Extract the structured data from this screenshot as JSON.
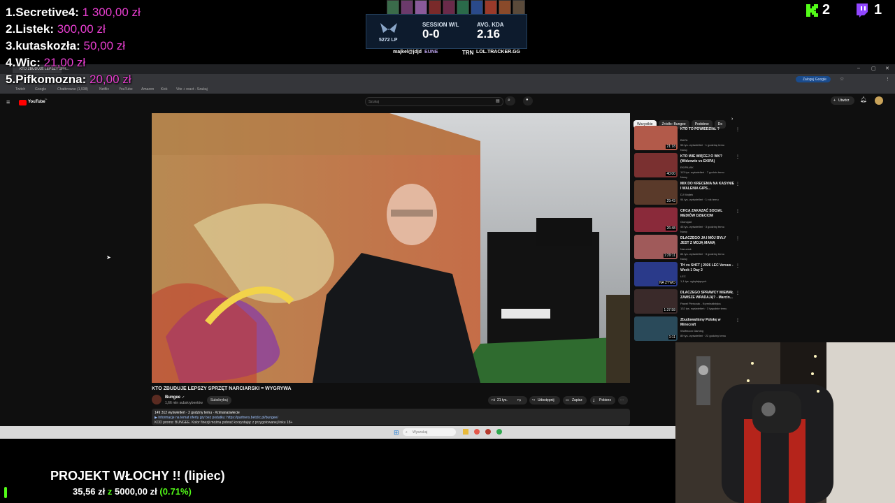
{
  "donations": [
    {
      "rank": "1.",
      "name": "Secretive4:",
      "amount": "1 300,00 zł"
    },
    {
      "rank": "2.",
      "name": "Listek:",
      "amount": "300,00 zł"
    },
    {
      "rank": "3.",
      "name": "kutaskozła:",
      "amount": "50,00 zł"
    },
    {
      "rank": "4.",
      "name": "Wic:",
      "amount": "21,00 zł"
    },
    {
      "rank": "5.",
      "name": "Pifkomozna:",
      "amount": "20,00 zł"
    }
  ],
  "tracker": {
    "lp": "5272 LP",
    "session_label": "SESSION W/L",
    "session_value": "0-0",
    "kda_label": "AVG. KDA",
    "kda_value": "2.16",
    "player": "majkel@jdjd",
    "region": "EUNE",
    "brand": "TRN",
    "site": "LOL.TRACKER.GG"
  },
  "platform_counts": {
    "kick": "2",
    "twitch": "1"
  },
  "colors": {
    "donation_amount": "#e83ed0",
    "kick": "#53fc18",
    "twitch": "#9146ff",
    "youtube_red": "#ff0000"
  },
  "browser": {
    "tab_title": "KTO ZBUDUJE LEPSZY SPR...",
    "account_button": "Zaloguj Google",
    "bookmarks": [
      "Twitch",
      "Google",
      "Chatbrowse (1,938)",
      "Netflix",
      "YouTube",
      "Amazon",
      "Kick",
      "Vite + react - Szukaj"
    ]
  },
  "youtube": {
    "logo": "YouTube",
    "logo_suffix": "PL",
    "search_placeholder": "Szukaj",
    "create_label": "Utwórz",
    "video_title": "KTO ZBUDUJE LEPSZY SPRZĘT NARCIARSKI = WYGRYWA",
    "channel": "Bungee",
    "subscribers": "1,66 mln subskrybentów",
    "subscribe": "Subskrybuj",
    "likes": "21 tys.",
    "share": "Udostępnij",
    "save": "Zapisz",
    "download": "Pobierz",
    "description_line1": "149 312 wyświetleń · 2 godziny temu · #zimanaświecie",
    "description_line2": "▶ Informacje na temat oferty gry bez podatku: https://partners.betclic.pl/bungee/",
    "description_line3": "KOD promo: BUNGEE. Kolor finezji można pobrać korzystając z przygotowanej linku 18+",
    "chips": [
      "Wszystkie",
      "Źródło: Bungee",
      "Podobne",
      "Do"
    ],
    "recommendations": [
      {
        "title": "KTO TO POWIEDZIAŁ ?",
        "channel": "BAZA",
        "meta": "56 tys. wyświetleń · 1 godzinę temu",
        "badge": "Nowy",
        "duration": "21:18"
      },
      {
        "title": "KTO WIE WIĘCEJ O WK? (Widzowie vs EKIPA)",
        "channel": "EKIPA WK",
        "meta": "113 tys. wyświetleń · 7 godzin temu",
        "badge": "Nowy",
        "duration": "40:00"
      },
      {
        "title": "MIX DO KRECENIA NA KASYNIE I WALENIA GIPS...",
        "channel": "DJ Wojtek",
        "meta": "94 tys. wyświetleń · 1 rok temu",
        "badge": "",
        "duration": "29:43"
      },
      {
        "title": "CHCĄ ZAKAZAĆ SOCIAL MEDIÓW DZIECIOM",
        "channel": "Glonojad",
        "meta": "45 tys. wyświetleń · 3 godziny temu",
        "badge": "Nowy",
        "duration": "26:48"
      },
      {
        "title": "DLACZEGO JA I MÓJ BYŁY JEST Z MOJĄ MAMĄ",
        "channel": "Naruciak",
        "meta": "84 tys. wyświetleń · 3 godziny temu",
        "badge": "Nowy",
        "duration": "1:29:11"
      },
      {
        "title": "TH vs SHFT | 2026 LEC Versus - Week 1 Day 2",
        "channel": "LEC",
        "meta": "1,1 tys. oglądających",
        "badge": "",
        "duration": "NA ŻYWO"
      },
      {
        "title": "DLACZEGO SPRAWCY MIEWAŁ ZAWSZE WPADAJĄ? - Marcin...",
        "channel": "Pawel Pieńczak - Kryminalistyka",
        "meta": "132 tys. wyświetleń · 3 tygodnie temu",
        "badge": "",
        "duration": "1:37:58"
      },
      {
        "title": "Zbudowaliśmy Polskę w Minecraft",
        "channel": "Wolfmoon Gaming",
        "meta": "89 tys. wyświetleń · 22 godziny temu",
        "badge": "",
        "duration": "1:11"
      }
    ]
  },
  "taskbar": {
    "search_placeholder": "Wyszukaj"
  },
  "goal": {
    "title": "PROJEKT WŁOCHY !! (lipiec)",
    "current": "35,56 zł",
    "separator": "z",
    "target": "5000,00 zł",
    "percent": "(0.71%)",
    "progress": 0.0071
  }
}
